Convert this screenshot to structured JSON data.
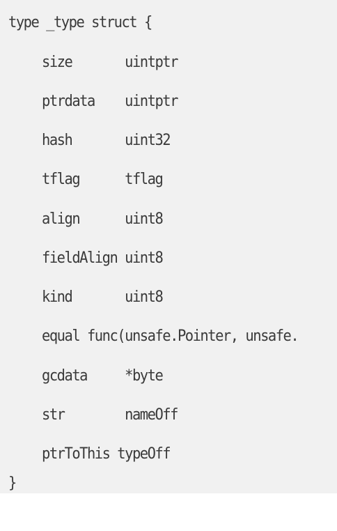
{
  "code": {
    "open": "type _type struct {",
    "fields": [
      "size       uintptr",
      "ptrdata    uintptr",
      "hash       uint32",
      "tflag      tflag",
      "align      uint8",
      "fieldAlign uint8",
      "kind       uint8",
      "equal func(unsafe.Pointer, unsafe.",
      "gcdata     *byte",
      "str        nameOff",
      "ptrToThis typeOff"
    ],
    "close": "}"
  }
}
